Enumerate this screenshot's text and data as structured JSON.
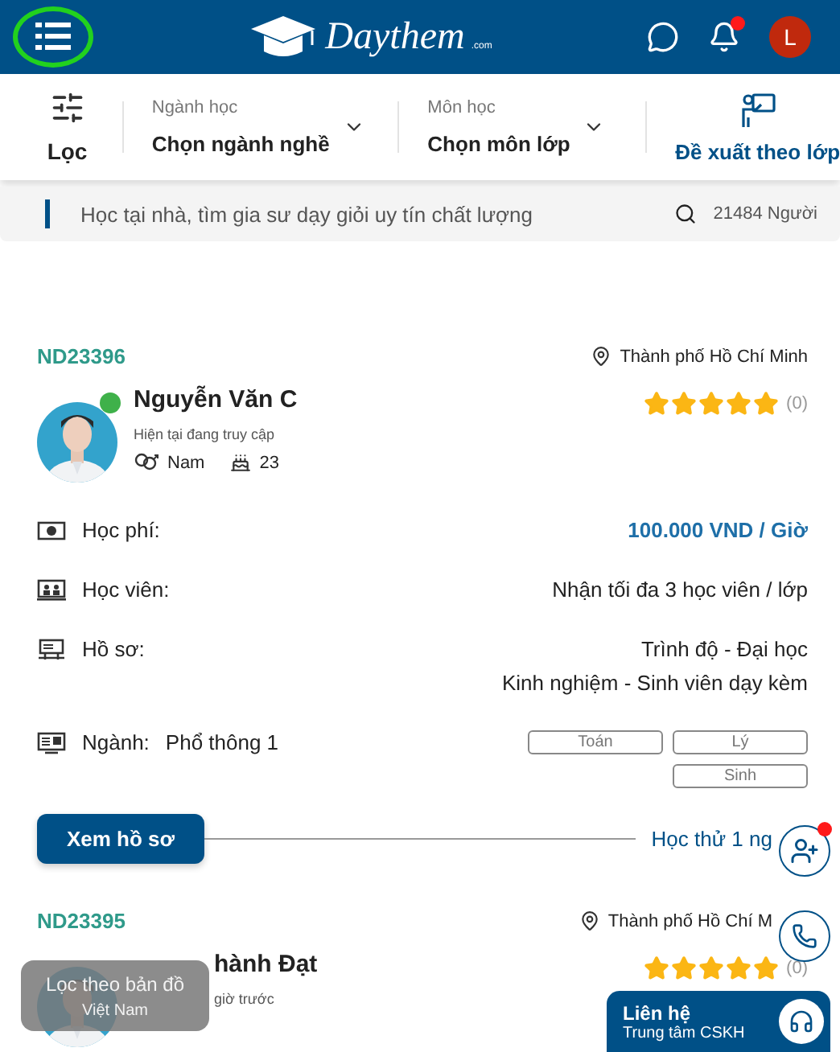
{
  "header": {
    "logo": {
      "name": "Daythem",
      "suffix": ".com"
    },
    "notifications_unread": true,
    "user_initial": "L"
  },
  "filter_bar": {
    "filter_label": "Lọc",
    "selects": [
      {
        "label": "Ngành học",
        "value": "Chọn ngành nghề"
      },
      {
        "label": "Môn học",
        "value": "Chọn môn lớp"
      }
    ],
    "suggest_label": "Đề xuất theo lớp"
  },
  "search": {
    "placeholder": "Học tại nhà, tìm gia sư dạy giỏi uy tín chất lượng",
    "count": "21484 Người"
  },
  "tutors": [
    {
      "code": "ND23396",
      "location": "Thành phố Hồ Chí Minh",
      "name": "Nguyễn Văn C",
      "online": true,
      "status": "Hiện tại đang truy cập",
      "gender": "Nam",
      "age": "23",
      "stars": 5,
      "rating_count": "(0)",
      "details": [
        {
          "kind": "fee",
          "label": "Học phí:",
          "values": [
            "100.000 VND / Giờ"
          ]
        },
        {
          "kind": "students",
          "label": "Học viên:",
          "values": [
            "Nhận tối đa 3 học viên / lớp"
          ]
        },
        {
          "kind": "profile",
          "label": "Hồ sơ:",
          "values": [
            "Trình độ - Đại học",
            "Kinh nghiệm - Sinh viên dạy kèm"
          ]
        },
        {
          "kind": "major",
          "label": "Ngành:",
          "major": "Phổ thông 1",
          "subjects": [
            "Toán",
            "Lý",
            "Sinh"
          ]
        }
      ],
      "action": "Xem hồ sơ",
      "trial": "Học thử 1 ng"
    },
    {
      "code": "ND23395",
      "location": "Thành phố Hồ Chí M",
      "name": "hành Đạt",
      "status": "giờ trước",
      "stars": 5,
      "rating_count": "(0)"
    }
  ],
  "map_filter": {
    "title": "Lọc theo bản đồ",
    "region": "Việt Nam"
  },
  "floating": {
    "invite_unread": true
  },
  "contact": {
    "title": "Liên hệ",
    "subtitle": "Trung tâm CSKH"
  }
}
